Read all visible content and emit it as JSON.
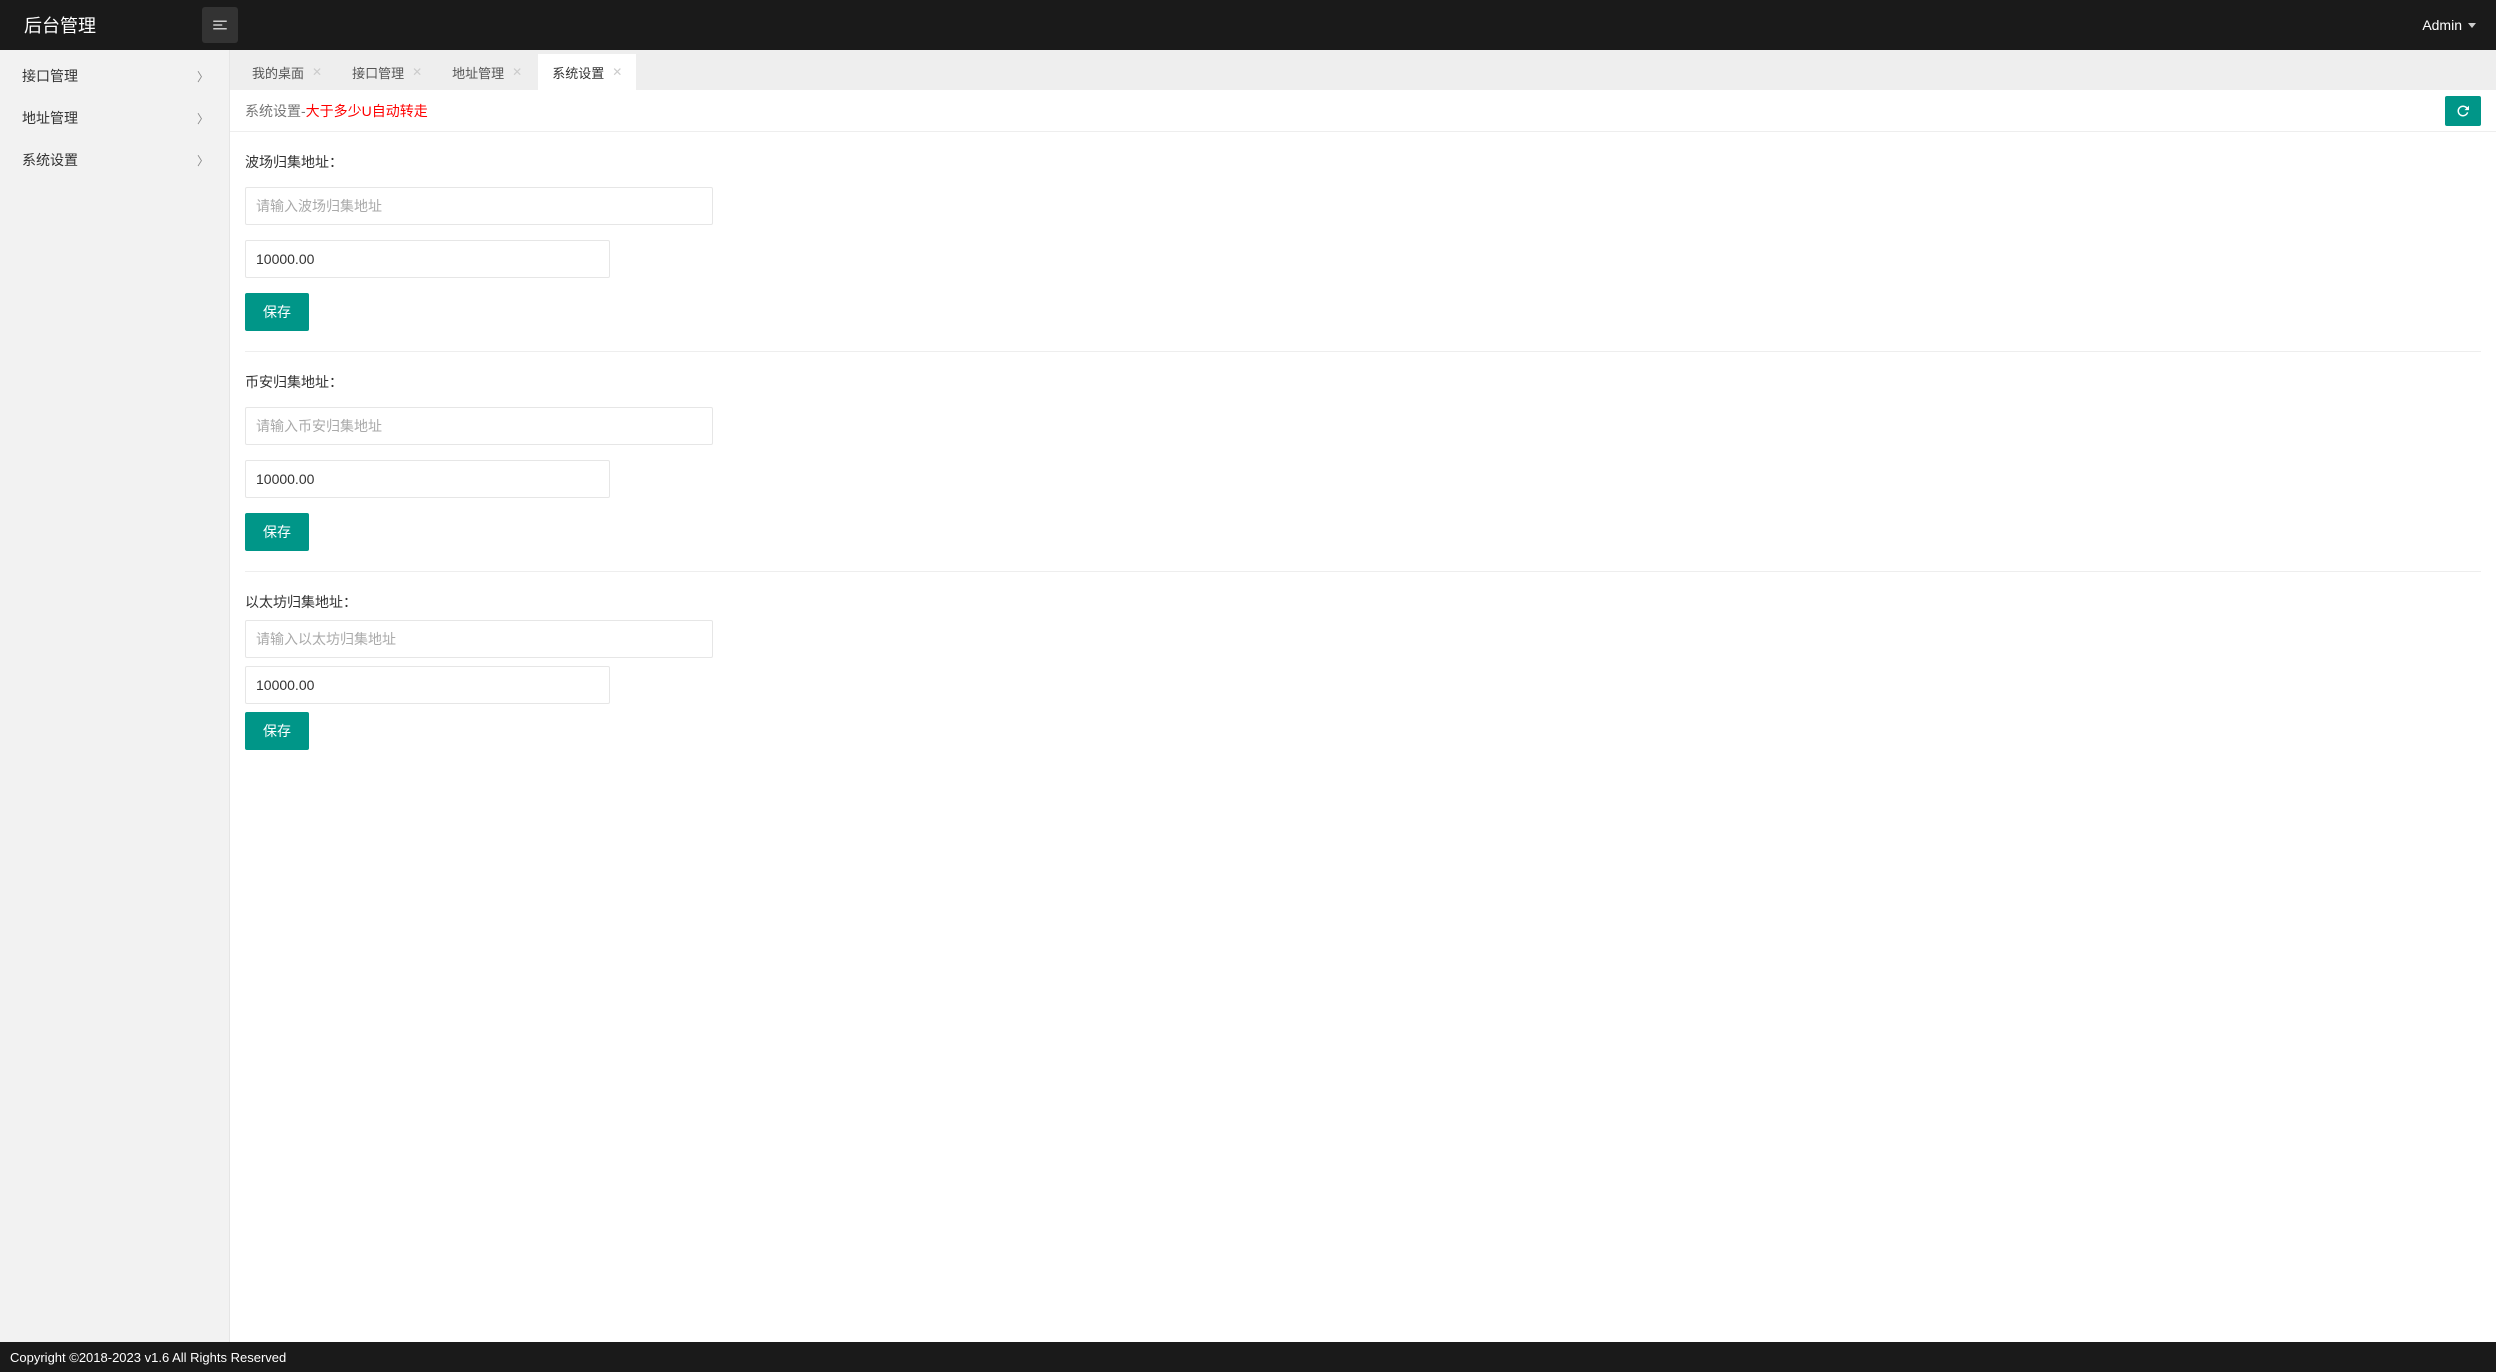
{
  "header": {
    "logo": "后台管理",
    "user_label": "Admin"
  },
  "sidebar": {
    "items": [
      {
        "label": "接口管理"
      },
      {
        "label": "地址管理"
      },
      {
        "label": "系统设置"
      }
    ]
  },
  "tabs": [
    {
      "label": "我的桌面",
      "active": false
    },
    {
      "label": "接口管理",
      "active": false
    },
    {
      "label": "地址管理",
      "active": false
    },
    {
      "label": "系统设置",
      "active": true
    }
  ],
  "content": {
    "title_prefix": "系统设置-",
    "title_highlight": "大于多少U自动转走",
    "sections": [
      {
        "label": "波场归集地址：",
        "address_placeholder": "请输入波场归集地址",
        "address_value": "",
        "amount_value": "10000.00",
        "save_label": "保存"
      },
      {
        "label": "币安归集地址：",
        "address_placeholder": "请输入币安归集地址",
        "address_value": "",
        "amount_value": "10000.00",
        "save_label": "保存"
      },
      {
        "label": "以太坊归集地址：",
        "address_placeholder": "请输入以太坊归集地址",
        "address_value": "",
        "amount_value": "10000.00",
        "save_label": "保存"
      }
    ]
  },
  "footer": {
    "text": "Copyright ©2018-2023 v1.6 All Rights Reserved"
  }
}
